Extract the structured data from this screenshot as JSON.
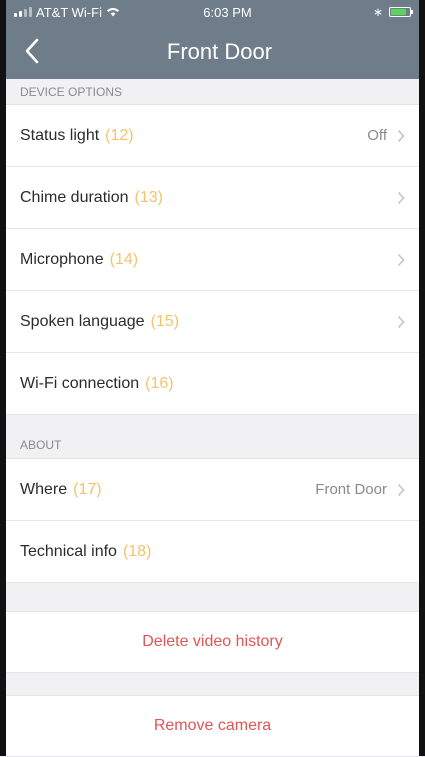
{
  "status_bar": {
    "carrier": "AT&T Wi-Fi",
    "time": "6:03 PM"
  },
  "nav": {
    "title": "Front Door"
  },
  "sections": {
    "device_options": {
      "header": "DEVICE OPTIONS",
      "rows": [
        {
          "label": "Status light",
          "num": "(12)",
          "value": "Off"
        },
        {
          "label": "Chime duration",
          "num": "(13)",
          "value": ""
        },
        {
          "label": "Microphone",
          "num": "(14)",
          "value": ""
        },
        {
          "label": "Spoken language",
          "num": "(15)",
          "value": ""
        },
        {
          "label": "Wi-Fi connection",
          "num": "(16)",
          "value": ""
        }
      ]
    },
    "about": {
      "header": "ABOUT",
      "rows": [
        {
          "label": "Where",
          "num": "(17)",
          "value": "Front Door"
        },
        {
          "label": "Technical info",
          "num": "(18)",
          "value": ""
        }
      ]
    }
  },
  "actions": {
    "delete_history": "Delete video history",
    "remove_camera": "Remove camera"
  },
  "colors": {
    "nav_bg": "#6f7c89",
    "accent_number": "#f3c46a",
    "danger": "#e05555"
  }
}
